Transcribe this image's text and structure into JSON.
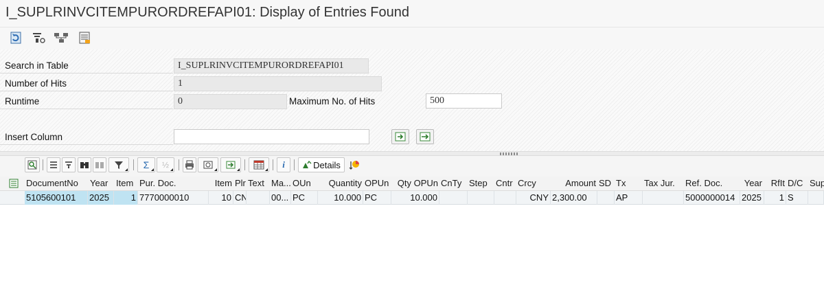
{
  "window": {
    "title": "I_SUPLRINVCITEMPURORDREFAPI01: Display of Entries Found"
  },
  "toolbar": {
    "icons": [
      "refresh-icon",
      "filter-settings-icon",
      "network-icon",
      "list-layout-icon"
    ]
  },
  "form": {
    "search_label": "Search in Table",
    "search_value": "I_SUPLRINVCITEMPURORDREFAPI01",
    "hits_label": "Number of Hits",
    "hits_value": "1",
    "runtime_label": "Runtime",
    "runtime_value": "0",
    "max_hits_label": "Maximum No. of Hits",
    "max_hits_value": "500",
    "insert_column_label": "Insert Column",
    "insert_column_value": ""
  },
  "alv_toolbar": {
    "details_label": "Details",
    "icons": [
      "detail-icon",
      "align-left-icon",
      "align-center-icon",
      "binoculars-icon",
      "find-next-icon",
      "filter-icon",
      "sum-icon",
      "subtotal-icon",
      "print-icon",
      "print-preview-icon",
      "export-icon",
      "spreadsheet-icon",
      "info-icon",
      "details-icon",
      "graphics-icon"
    ]
  },
  "table": {
    "columns": [
      "DocumentNo",
      "Year",
      "Item",
      "Pur. Doc.",
      "Item",
      "Plr",
      "Text",
      "Ma...",
      "OUn",
      "Quantity",
      "OPUn",
      "Qty OPUn",
      "CnTy",
      "Step",
      "Cntr",
      "Crcy",
      "Amount",
      "SD",
      "Tx",
      "Tax Jur.",
      "Ref. Doc.",
      "Year",
      "RfIt",
      "D/C",
      "Sup"
    ],
    "rows": [
      [
        "5105600101",
        "2025",
        "1",
        "7770000010",
        "10",
        "CN",
        "",
        "00...",
        "PC",
        "10.000",
        "PC",
        "10.000",
        "",
        "",
        "",
        "CNY",
        "2,300.00",
        "",
        "AP",
        "",
        "5000000014",
        "2025",
        "1",
        "S",
        ""
      ]
    ]
  }
}
